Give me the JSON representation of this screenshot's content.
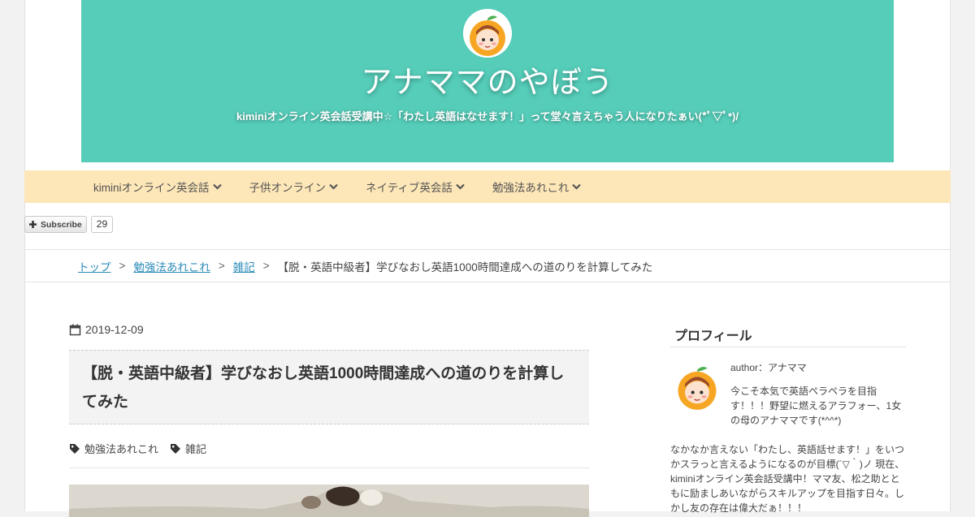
{
  "site": {
    "title": "アナママのやぼう",
    "description": "kiminiオンライン英会話受講中☆「わたし英語はなせます！」って堂々言えちゃう人になりたぁい(*ﾟ▽ﾟ*)/",
    "header_color": "#55cdb9"
  },
  "nav": {
    "items": [
      {
        "label": "kiminiオンライン英会話",
        "icon": "chevron-down-icon"
      },
      {
        "label": "子供オンライン",
        "icon": "chevron-down-icon"
      },
      {
        "label": "ネイティブ英会話",
        "icon": "chevron-down-icon"
      },
      {
        "label": "勉強法あれこれ",
        "icon": "chevron-down-icon"
      }
    ],
    "background": "#fde6b7"
  },
  "subscribe": {
    "label": "Subscribe",
    "count": "29",
    "icon": "plus-icon"
  },
  "breadcrumb": {
    "items": [
      "トップ",
      "勉強法あれこれ",
      "雑記"
    ],
    "separator": ">",
    "current": "【脱・英語中級者】学びなおし英語1000時間達成への道のりを計算してみた"
  },
  "post": {
    "date": "2019-12-09",
    "date_icon": "calendar-icon",
    "title": "【脱・英語中級者】学びなおし英語1000時間達成への道のりを計算してみた",
    "tags": [
      {
        "label": "勉強法あれこれ",
        "icon": "tag-icon"
      },
      {
        "label": "雑記",
        "icon": "tag-icon"
      }
    ]
  },
  "sidebar": {
    "title": "プロフィール",
    "author": "author：アナママ",
    "intro": "今こそ本気で英語ペラペラを目指す！！！野望に燃えるアラフォー、1女の母のアナママです(*^^*)",
    "body": "なかなか言えない「わたし、英語話せます！」をいつかスラっと言えるようになるのが目標(´▽｀)ノ 現在、kiminiオンライン英会話受講中！ママ友、松之助とともに励ましあいながらスキルアップを目指す日々。しかし友の存在は偉大だぁ！！！"
  }
}
